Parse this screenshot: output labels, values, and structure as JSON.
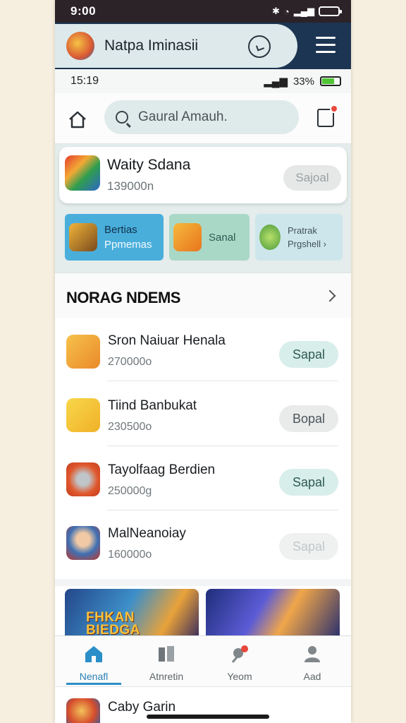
{
  "status_bar": {
    "time": "9:00"
  },
  "app_bar": {
    "title": "Natpa Iminasii"
  },
  "sub_status": {
    "time": "15:19",
    "battery": "33%"
  },
  "search": {
    "placeholder": "Gaural Amauh."
  },
  "featured": {
    "title": "Waity Sdana",
    "subtitle": "139000n",
    "button": "Sajoal"
  },
  "categories": [
    {
      "line1": "Bertias",
      "line2": "Ppmemas",
      "color": "#4aaedb"
    },
    {
      "line1": "Sanal",
      "line2": "",
      "color": "#a9d8c7"
    },
    {
      "line1": "Pratrak",
      "line2": "Prgshell",
      "color": "#cde6ec"
    }
  ],
  "section": {
    "title": "NORAG NDEMS"
  },
  "apps": [
    {
      "name": "Sron Naiuar Henala",
      "size": "270000o",
      "button": "Sapal",
      "style": "green"
    },
    {
      "name": "Tiind Banbukat",
      "size": "230500o",
      "button": "Bopal",
      "style": "gray"
    },
    {
      "name": "Tayolfaag Berdien",
      "size": "250000g",
      "button": "Sapal",
      "style": "green"
    },
    {
      "name": "MalNeanoiay",
      "size": "160000o",
      "button": "Sapal",
      "style": "faint"
    }
  ],
  "banners": [
    {
      "text": "FHKAN\nBIEDGA"
    },
    {
      "text": ""
    }
  ],
  "nav": [
    {
      "label": "Nenafl",
      "active": true
    },
    {
      "label": "Atnretin",
      "active": false
    },
    {
      "label": "Yeom",
      "active": false
    },
    {
      "label": "Aad",
      "active": false
    }
  ],
  "peek_item": {
    "name": "Caby Garin"
  },
  "colors": {
    "accent": "#2a8fc8",
    "header_dark": "#1c3552",
    "button_green": "#d8eeea"
  }
}
